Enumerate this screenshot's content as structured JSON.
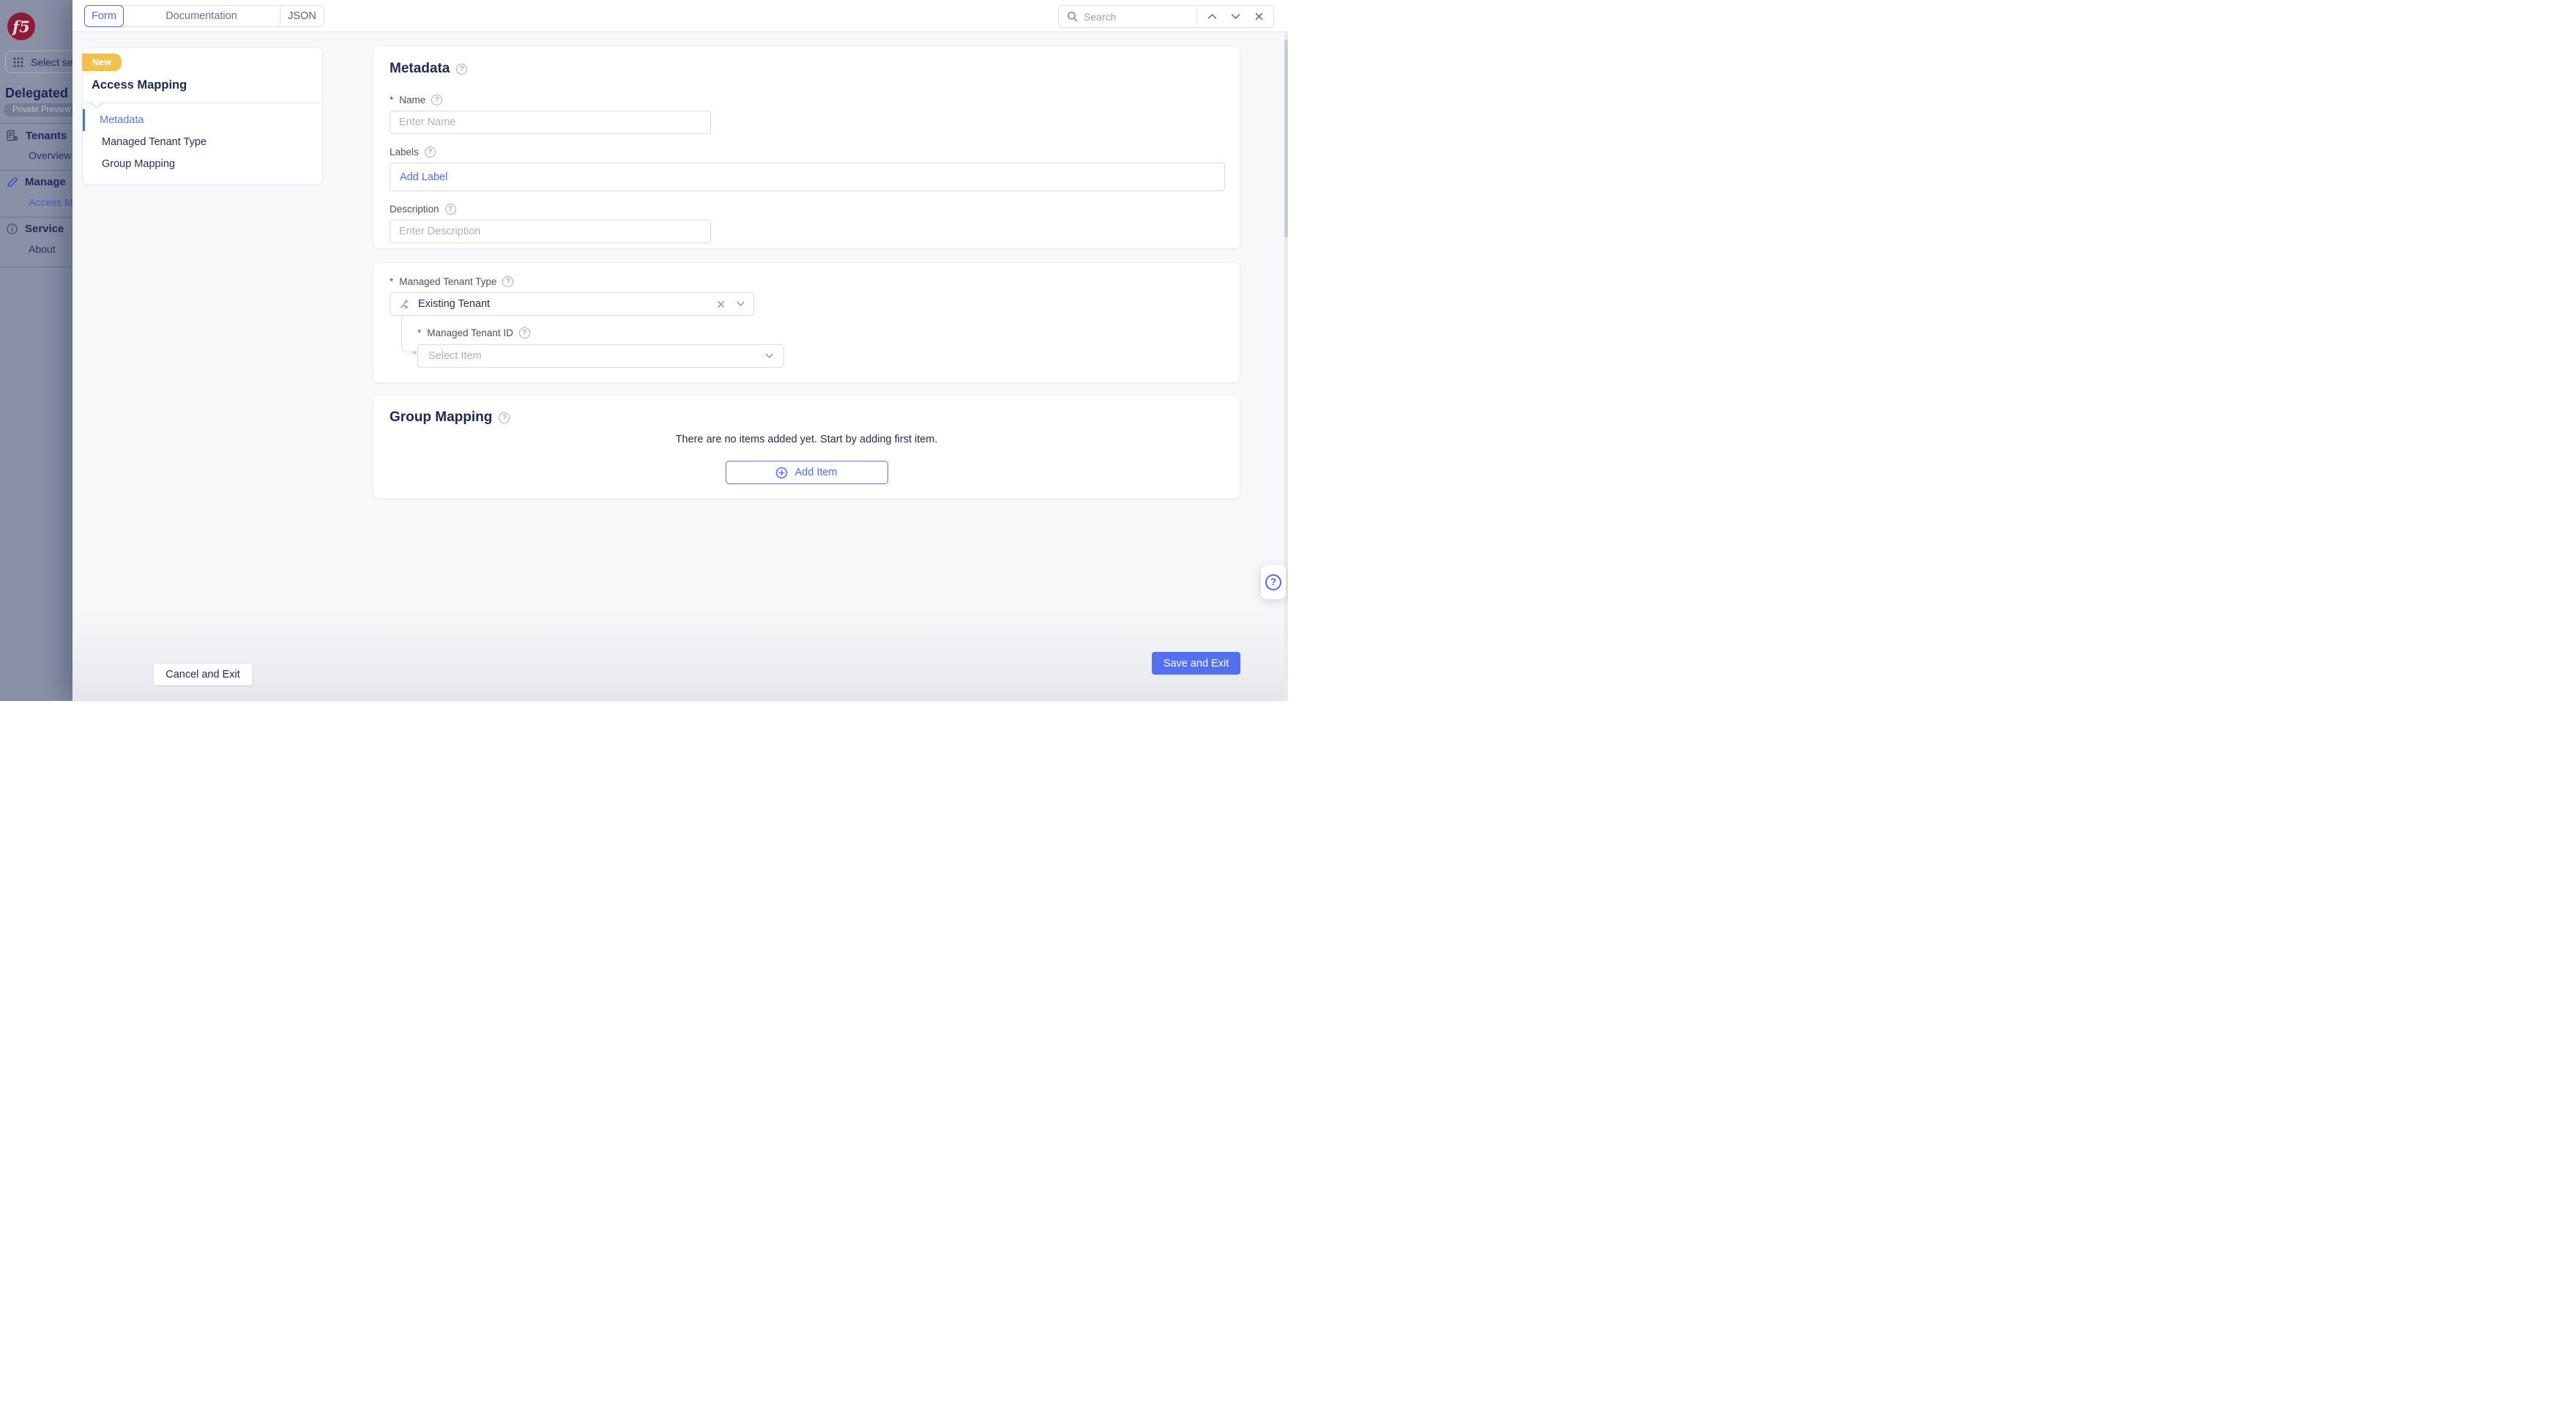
{
  "sidebar": {
    "logo_text": "f5",
    "select_service": "Select se",
    "title": "Delegated",
    "badge": "Private Preview",
    "groups": [
      {
        "header": "Tenants",
        "item": "Overview"
      },
      {
        "header": "Manage",
        "item": "Access M"
      },
      {
        "header": "Service",
        "item": "About"
      }
    ]
  },
  "topbar": {
    "tabs": [
      {
        "label": "Form"
      },
      {
        "label": "Documentation"
      },
      {
        "label": "JSON"
      }
    ],
    "search": {
      "placeholder": "Search"
    }
  },
  "nav_card": {
    "badge": "New",
    "title": "Access Mapping",
    "items": [
      {
        "label": "Metadata"
      },
      {
        "label": "Managed Tenant Type"
      },
      {
        "label": "Group Mapping"
      }
    ]
  },
  "form": {
    "required_mark": "*",
    "metadata": {
      "title": "Metadata",
      "name_label": "Name",
      "name_placeholder": "Enter Name",
      "labels_label": "Labels",
      "add_label": "Add Label",
      "description_label": "Description",
      "description_placeholder": "Enter Description"
    },
    "tenant_type": {
      "label": "Managed Tenant Type",
      "value": "Existing Tenant",
      "id_label": "Managed Tenant ID",
      "id_placeholder": "Select Item"
    },
    "group_mapping": {
      "title": "Group Mapping",
      "empty_text": "There are no items added yet. Start by adding first item.",
      "add_item_label": "Add Item"
    }
  },
  "footer": {
    "cancel_label": "Cancel and Exit",
    "save_label": "Save and Exit"
  },
  "help": {
    "question_glyph": "?"
  },
  "colors": {
    "accent": "#4a6cf5",
    "save_button": "#5470f0",
    "badge_new": "#f2c14d",
    "f5_red": "#8c1a39"
  }
}
